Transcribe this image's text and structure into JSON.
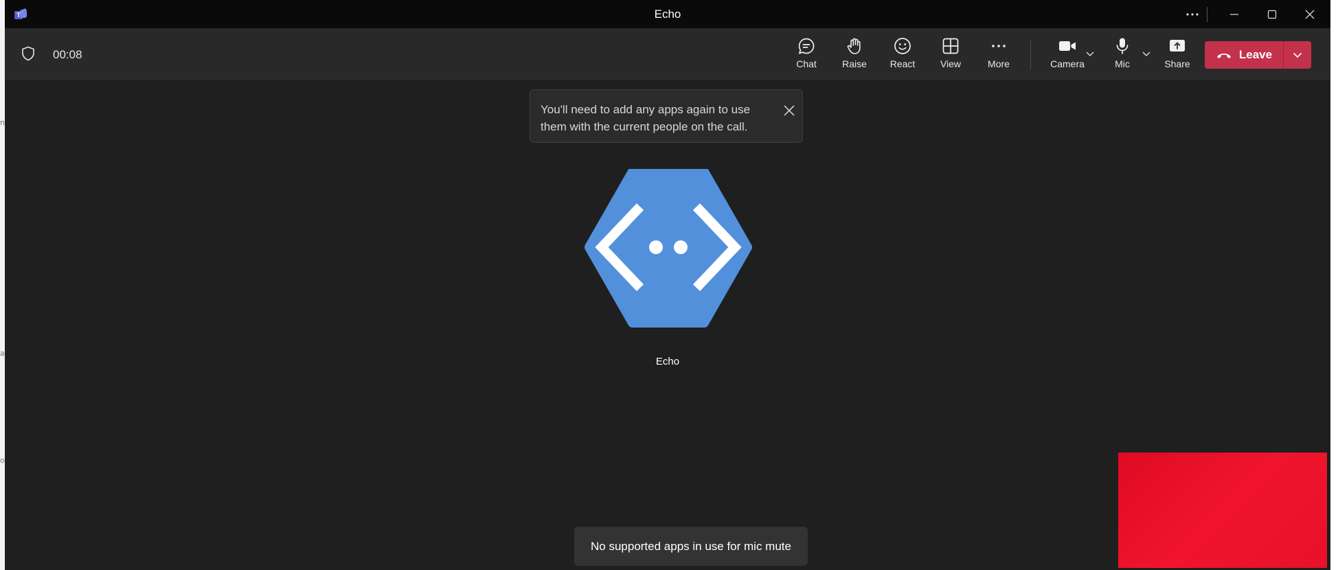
{
  "window": {
    "title": "Echo",
    "more_icon": "ellipsis-icon",
    "minimize_icon": "minimize-icon",
    "maximize_icon": "maximize-icon",
    "close_icon": "close-icon"
  },
  "call": {
    "timer": "00:08",
    "toolbar": [
      {
        "key": "chat",
        "label": "Chat",
        "icon": "chat-icon"
      },
      {
        "key": "raise",
        "label": "Raise",
        "icon": "hand-icon"
      },
      {
        "key": "react",
        "label": "React",
        "icon": "smile-icon"
      },
      {
        "key": "view",
        "label": "View",
        "icon": "grid-icon"
      },
      {
        "key": "more",
        "label": "More",
        "icon": "ellipsis-icon"
      },
      {
        "key": "camera",
        "label": "Camera",
        "icon": "camera-icon"
      },
      {
        "key": "mic",
        "label": "Mic",
        "icon": "mic-icon"
      },
      {
        "key": "share",
        "label": "Share",
        "icon": "share-icon"
      }
    ],
    "leave_label": "Leave",
    "leave_color": "#c4314b"
  },
  "notice": {
    "text": "You'll need to add any apps again to use them with the current people on the call."
  },
  "participant": {
    "name": "Echo",
    "avatar_color": "#5290dc"
  },
  "toast": {
    "text": "No supported apps in use for mic mute"
  },
  "self_view_color": "#e8102a"
}
